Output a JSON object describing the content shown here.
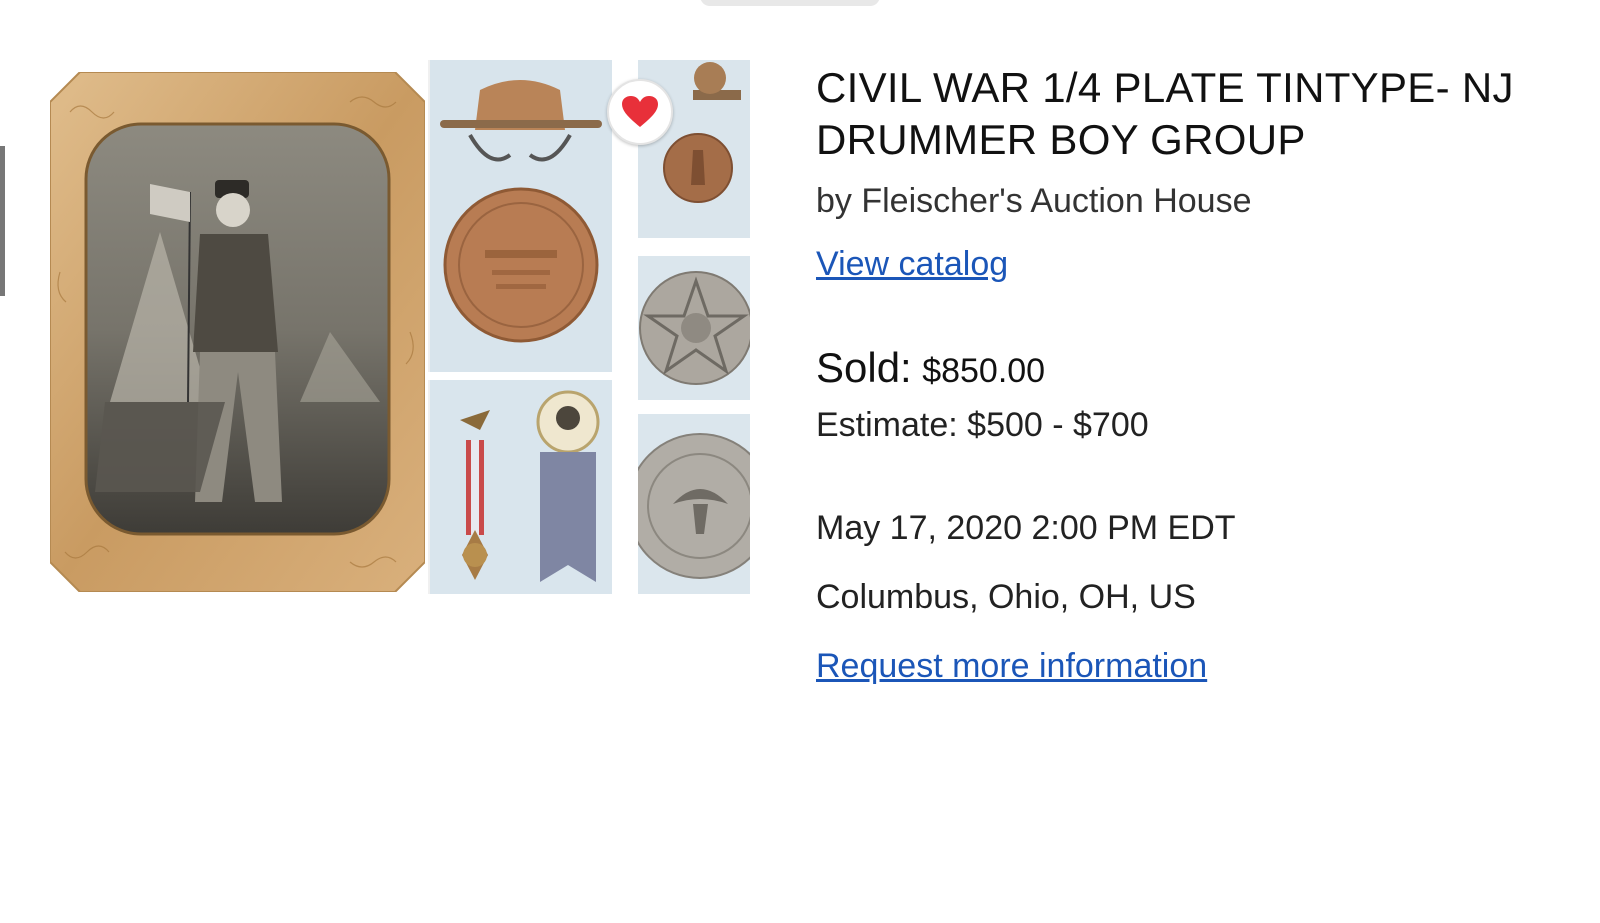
{
  "listing": {
    "title": "CIVIL WAR 1/4 PLATE TINTYPE- NJ DRUMMER BOY GROUP",
    "seller_line": "by Fleischer's Auction House",
    "view_catalog_label": "View catalog",
    "sold_label": "Sold:",
    "sold_price": "$850.00",
    "estimate": "Estimate: $500 - $700",
    "date": "May 17, 2020 2:00 PM EDT",
    "location": "Columbus, Ohio, OH, US",
    "request_info_label": "Request more information"
  },
  "gallery": {
    "main_image": "tintype-photo",
    "thumbnails": [
      "new-jersey-medal",
      "gar-ribbons-badges",
      "small-bronze-medal",
      "star-medal",
      "eagle-medal"
    ],
    "favorite_icon": "heart-icon"
  },
  "colors": {
    "link": "#1b56b8",
    "heart": "#e8303a",
    "frame_gold": "#c9a06a"
  }
}
